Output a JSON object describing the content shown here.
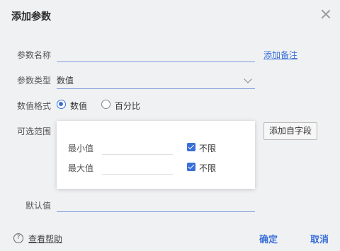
{
  "dialog": {
    "title": "添加参数"
  },
  "fields": {
    "name_label": "参数名称",
    "name_value": "",
    "add_note_link": "添加备注",
    "type_label": "参数类型",
    "type_value": "数值",
    "format_label": "数值格式",
    "format_options": [
      {
        "label": "数值",
        "selected": true
      },
      {
        "label": "百分比",
        "selected": false
      }
    ],
    "range_label": "可选范围",
    "range": {
      "min_label": "最小值",
      "min_value": "",
      "min_unlimited_label": "不限",
      "min_unlimited": true,
      "max_label": "最大值",
      "max_value": "",
      "max_unlimited_label": "不限",
      "max_unlimited": true
    },
    "add_field_button": "添加自字段",
    "default_label": "默认值",
    "default_value": ""
  },
  "footer": {
    "help_icon": "?",
    "help_text": "查看帮助",
    "confirm": "确定",
    "cancel": "取消"
  },
  "colors": {
    "accent": "#3a6fd8",
    "background": "#f0f1f3"
  }
}
